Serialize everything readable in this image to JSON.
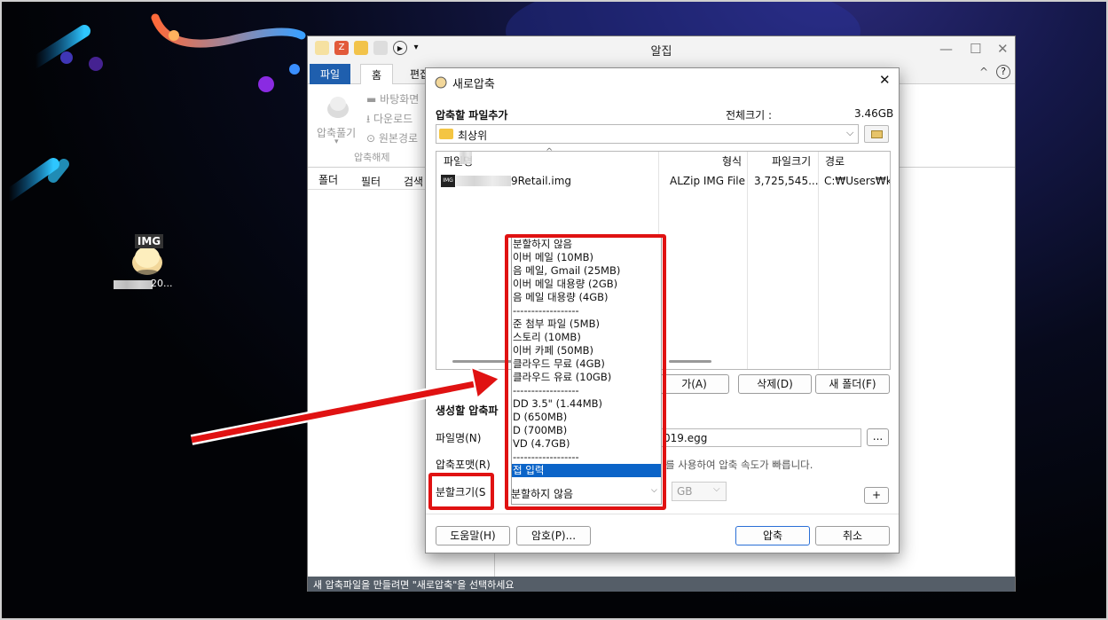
{
  "desktop": {
    "icon_badge": "IMG",
    "icon_label": "20..."
  },
  "app": {
    "title": "알집",
    "tabs": [
      "파일",
      "홈",
      "편집"
    ],
    "ribbon": {
      "compress_label": "압축풀기",
      "group_label": "압축해제",
      "items": [
        "바탕화면",
        "다운로드",
        "원본경로"
      ]
    },
    "left_tabs": [
      "폴더",
      "필터",
      "검색"
    ],
    "status": "새 압축파일을 만들려면 \"새로압축\"을 선택하세요"
  },
  "dialog": {
    "title": "새로압축",
    "add_files_label": "압축할 파일추가",
    "total_size_label": "전체크기 :",
    "total_size_value": "3.46GB",
    "folder_path": "최상위",
    "columns": [
      "파일명",
      "형식",
      "파일크기",
      "경로"
    ],
    "rows": [
      {
        "name": "9Retail.img",
        "type": "ALZip IMG File",
        "size": "3,725,545...",
        "path": "C:₩Users₩kim"
      }
    ],
    "buttons": {
      "add": "가(A)",
      "delete": "삭제(D)",
      "new_folder": "새 폴더(F)"
    },
    "create_section_label": "생성할 압축파",
    "filename_label": "파일명(N)",
    "filename_value": "019.egg",
    "browse_label": "...",
    "format_label": "압축포맷(R)",
    "format_note": "를 사용하여 압축 속도가 빠릅니다.",
    "split_label": "분할크기(S",
    "split_value": "분할하지 않음",
    "unit": "GB",
    "plus": "+",
    "help": "도움말(H)",
    "password": "암호(P)...",
    "compress": "압축",
    "cancel": "취소",
    "close_icon": "✕"
  },
  "split_options": [
    "분할하지 않음",
    "이버 메일 (10MB)",
    "음 메일, Gmail (25MB)",
    "이버 메일 대용량 (2GB)",
    "음 메일 대용량 (4GB)",
    "------------------",
    "준 첨부 파일 (5MB)",
    "스토리 (10MB)",
    "이버 카페 (50MB)",
    "클라우드 무료 (4GB)",
    "클라우드 유료 (10GB)",
    "------------------",
    "DD 3.5\" (1.44MB)",
    "D (650MB)",
    "D (700MB)",
    "VD (4.7GB)",
    "------------------",
    "접 입력"
  ],
  "colors": {
    "highlight": "#e01212",
    "selection": "#0b64c8",
    "file_tab": "#1f5fae"
  }
}
